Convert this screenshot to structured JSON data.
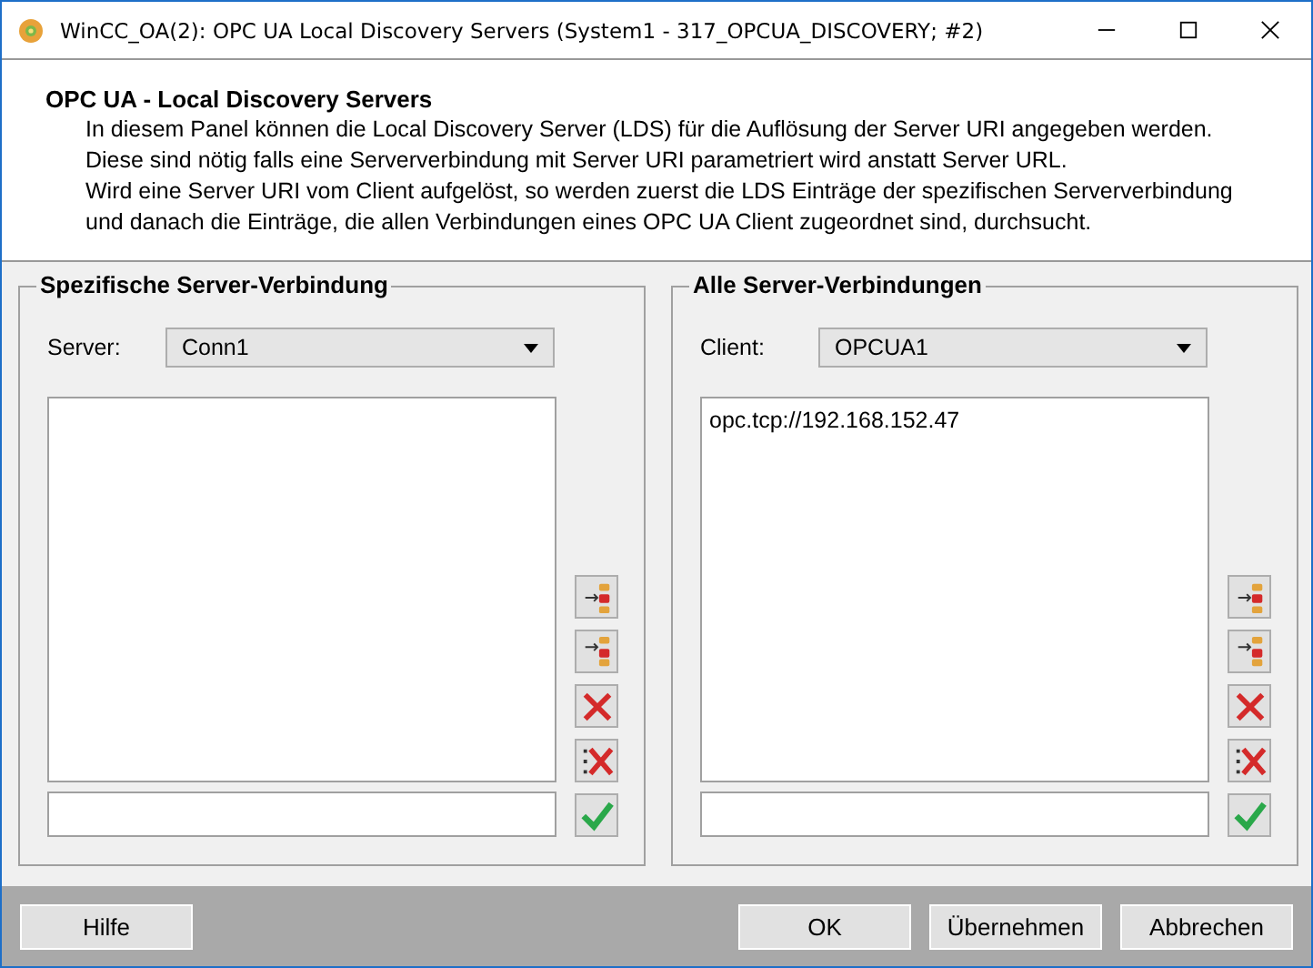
{
  "window": {
    "title": "WinCC_OA(2): OPC UA Local Discovery Servers (System1 - 317_OPCUA_DISCOVERY; #2)"
  },
  "header": {
    "title": "OPC UA - Local Discovery Servers",
    "lines": [
      "In diesem Panel können die Local Discovery Server (LDS) für die Auflösung der Server URI angegeben werden.",
      "Diese sind nötig falls eine Serververbindung mit Server URI parametriert wird anstatt Server URL.",
      "Wird eine Server URI vom Client aufgelöst, so werden zuerst die LDS Einträge der spezifischen Serververbindung",
      "und danach die Einträge, die allen Verbindungen eines OPC UA Client zugeordnet sind, durchsucht."
    ]
  },
  "groups": [
    {
      "legend": "Spezifische Server-Verbindung",
      "label": "Server:",
      "selection": "Conn1",
      "tools": [
        {
          "kind": "insert-above"
        },
        {
          "kind": "insert-below"
        },
        {
          "kind": "delete"
        },
        {
          "kind": "delete-all"
        },
        {
          "kind": "confirm"
        }
      ]
    },
    {
      "legend": "Alle Server-Verbindungen",
      "label": "Client:",
      "selection": "OPCUA1",
      "entries": [
        "opc.tcp://192.168.152.47"
      ],
      "tools": [
        {
          "kind": "insert-above"
        },
        {
          "kind": "insert-below"
        },
        {
          "kind": "delete"
        },
        {
          "kind": "delete-all"
        },
        {
          "kind": "confirm"
        }
      ]
    }
  ],
  "buttons_left": [
    "Hilfe"
  ],
  "buttons_right": [
    "OK",
    "Übernehmen",
    "Abbrechen"
  ]
}
